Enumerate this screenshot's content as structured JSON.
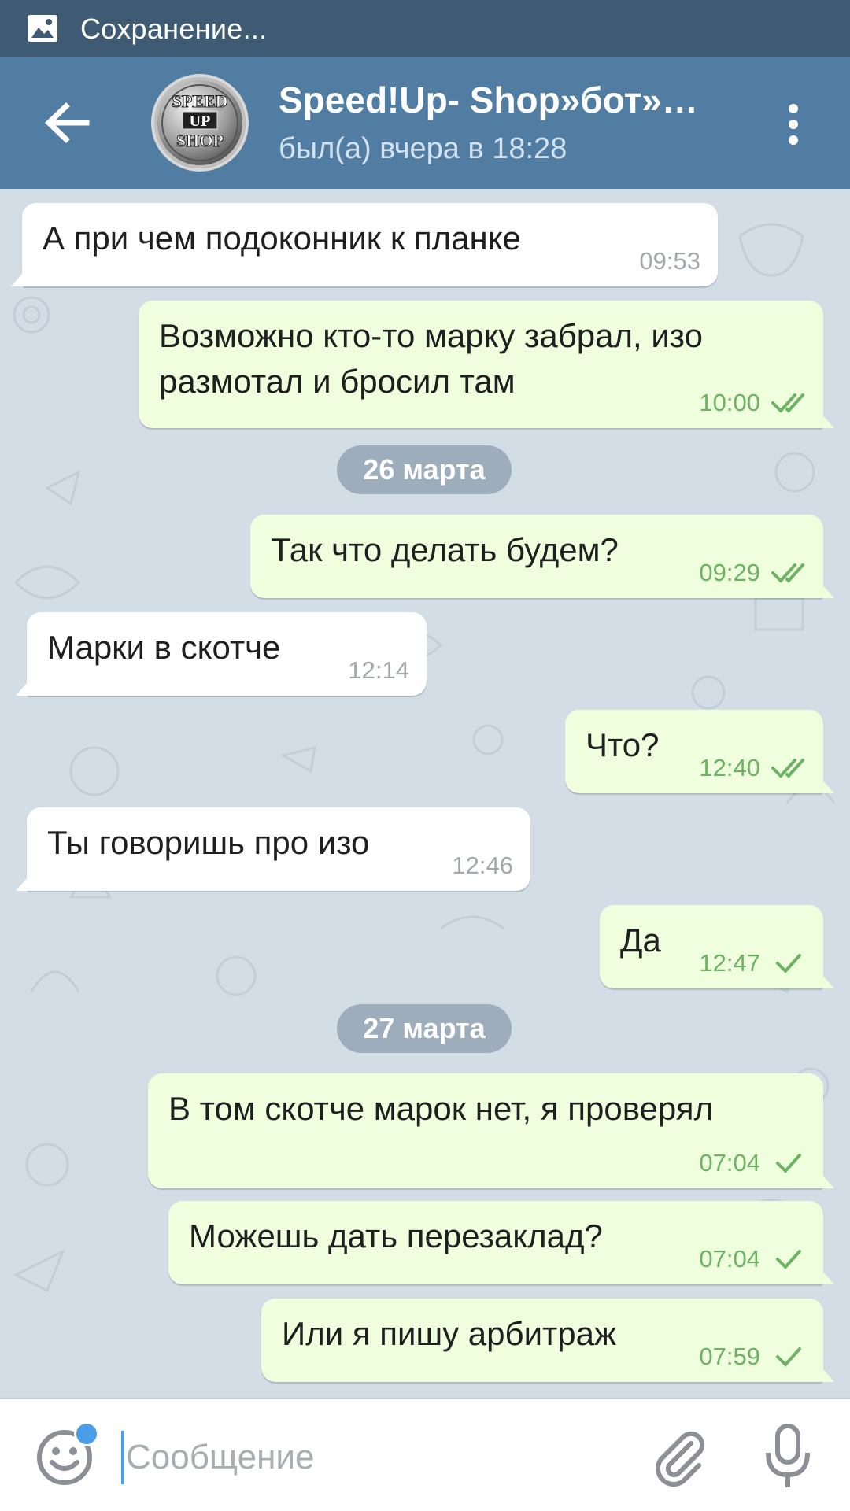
{
  "status_bar": {
    "icon": "image-icon",
    "text": "Сохранение..."
  },
  "header": {
    "title": "Speed!Up- Shop»бот»…",
    "subtitle": "был(а) вчера в 18:28",
    "avatar_text": [
      "SPEED",
      "UP",
      "SHOP"
    ],
    "back_icon": "arrow-left-icon",
    "menu_icon": "more-vertical-icon"
  },
  "messages": [
    {
      "direction": "in",
      "lines": [
        "А при чем подоконник к планке"
      ],
      "time": "09:53"
    },
    {
      "direction": "out",
      "lines": [
        "Возможно кто-то марку забрал, изо",
        "размотал и бросил там"
      ],
      "time": "10:00",
      "status": "read"
    },
    {
      "type": "date",
      "text": "26 марта"
    },
    {
      "direction": "out",
      "lines": [
        "Так что делать будем?"
      ],
      "time": "09:29",
      "status": "read"
    },
    {
      "direction": "in",
      "lines": [
        "Марки в скотче"
      ],
      "time": "12:14"
    },
    {
      "direction": "out",
      "lines": [
        "Что?"
      ],
      "time": "12:40",
      "status": "read"
    },
    {
      "direction": "in",
      "lines": [
        "Ты говоришь про изо"
      ],
      "time": "12:46"
    },
    {
      "direction": "out",
      "lines": [
        "Да"
      ],
      "time": "12:47",
      "status": "sent"
    },
    {
      "type": "date",
      "text": "27 марта"
    },
    {
      "direction": "out",
      "lines": [
        "В том скотче марок нет, я проверял"
      ],
      "time": "07:04",
      "status": "sent"
    },
    {
      "direction": "out",
      "lines": [
        "Можешь дать перезаклад?"
      ],
      "time": "07:04",
      "status": "sent"
    },
    {
      "direction": "out",
      "lines": [
        "Или я пишу арбитраж"
      ],
      "time": "07:59",
      "status": "sent"
    }
  ],
  "composer": {
    "placeholder": "Сообщение",
    "value": "",
    "emoji_icon": "smile-icon",
    "attach_icon": "paperclip-icon",
    "mic_icon": "microphone-icon"
  },
  "colors": {
    "status_bar": "#3f5a73",
    "header": "#527da3",
    "chat_background": "#d3dde6",
    "incoming_bubble": "#ffffff",
    "outgoing_bubble": "#effedd",
    "outgoing_time": "#6eb364",
    "incoming_time": "#a3a8ad",
    "accent": "#4a9de6"
  }
}
